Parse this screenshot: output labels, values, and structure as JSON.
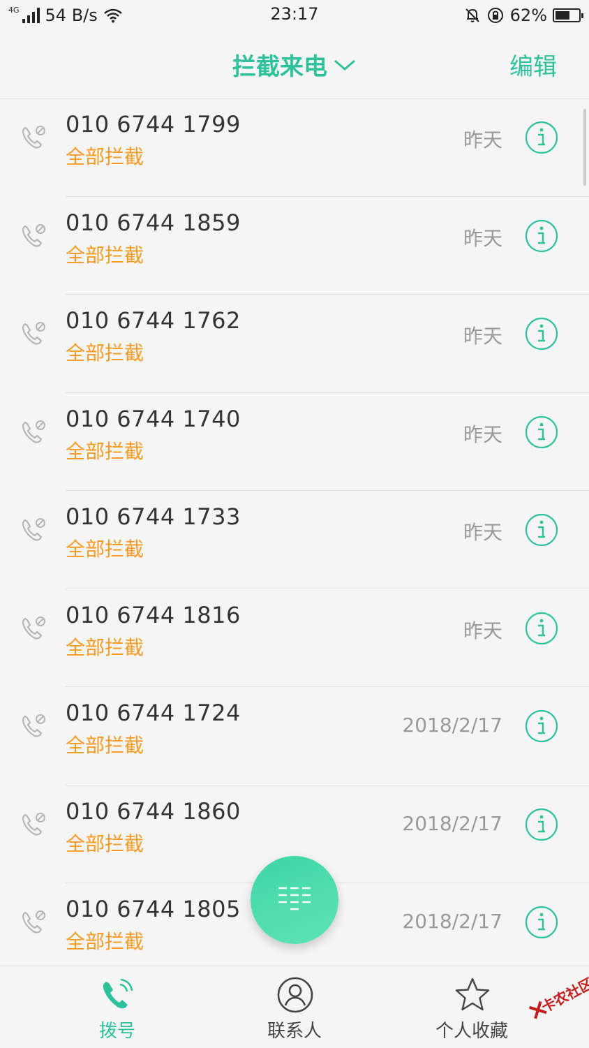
{
  "status_bar": {
    "network_type": "4G",
    "speed": "54 B/s",
    "time": "23:17",
    "battery": "62%",
    "battery_level": 0.62
  },
  "header": {
    "title": "拦截来电",
    "edit_label": "编辑"
  },
  "calls": [
    {
      "number": "010 6744 1799",
      "tag": "全部拦截",
      "time": "昨天"
    },
    {
      "number": "010 6744 1859",
      "tag": "全部拦截",
      "time": "昨天"
    },
    {
      "number": "010 6744 1762",
      "tag": "全部拦截",
      "time": "昨天"
    },
    {
      "number": "010 6744 1740",
      "tag": "全部拦截",
      "time": "昨天"
    },
    {
      "number": "010 6744 1733",
      "tag": "全部拦截",
      "time": "昨天"
    },
    {
      "number": "010 6744 1816",
      "tag": "全部拦截",
      "time": "昨天"
    },
    {
      "number": "010 6744 1724",
      "tag": "全部拦截",
      "time": "2018/2/17"
    },
    {
      "number": "010 6744 1860",
      "tag": "全部拦截",
      "time": "2018/2/17"
    },
    {
      "number": "010 6744 1805",
      "tag": "全部拦截",
      "time": "2018/2/17"
    }
  ],
  "bottom_nav": {
    "dial": "拨号",
    "contacts": "联系人",
    "favorites": "个人收藏"
  },
  "watermark": {
    "text": "卡农社区"
  },
  "colors": {
    "accent": "#2fc29a",
    "tag": "#f59a23",
    "muted": "#999999"
  }
}
